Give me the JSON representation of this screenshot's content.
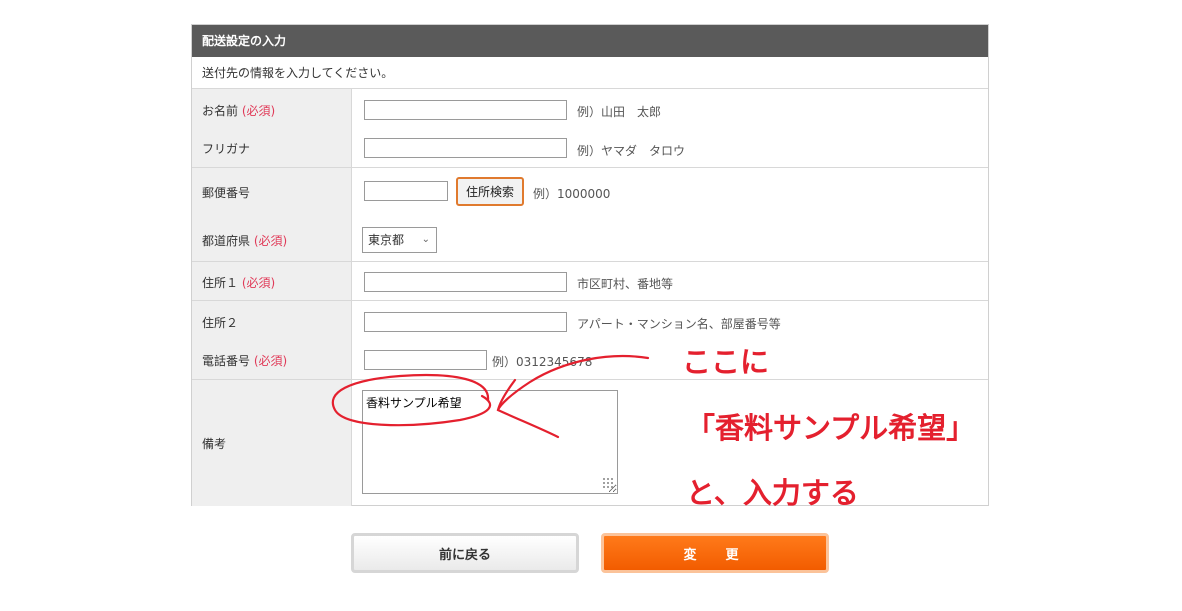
{
  "form": {
    "title": "配送設定の入力",
    "intro": "送付先の情報を入力してください。",
    "required_mark": "(必須)",
    "fields": {
      "name": {
        "label": "お名前",
        "hint": "例）山田　太郎",
        "value": ""
      },
      "furigana": {
        "label": "フリガナ",
        "hint": "例）ヤマダ　タロウ",
        "value": ""
      },
      "postal": {
        "label": "郵便番号",
        "hint": "例）1000000",
        "value": "",
        "search_button": "住所検索"
      },
      "prefecture": {
        "label": "都道府県",
        "selected": "東京都"
      },
      "address1": {
        "label": "住所１",
        "hint": "市区町村、番地等",
        "value": ""
      },
      "address2": {
        "label": "住所２",
        "hint": "アパート・マンション名、部屋番号等",
        "value": ""
      },
      "phone": {
        "label": "電話番号",
        "hint": "例）0312345678",
        "value": ""
      },
      "remarks": {
        "label": "備考",
        "value": "香料サンプル希望"
      }
    }
  },
  "buttons": {
    "back": "前に戻る",
    "change": "変　更"
  },
  "annotation": {
    "line1": "ここに",
    "line2": "「香料サンプル希望」",
    "line3": "と、入力する",
    "color": "#e4202e"
  },
  "colors": {
    "header_bg": "#5a5a5a",
    "required": "#e03a58",
    "accent_orange": "#f25c00"
  }
}
